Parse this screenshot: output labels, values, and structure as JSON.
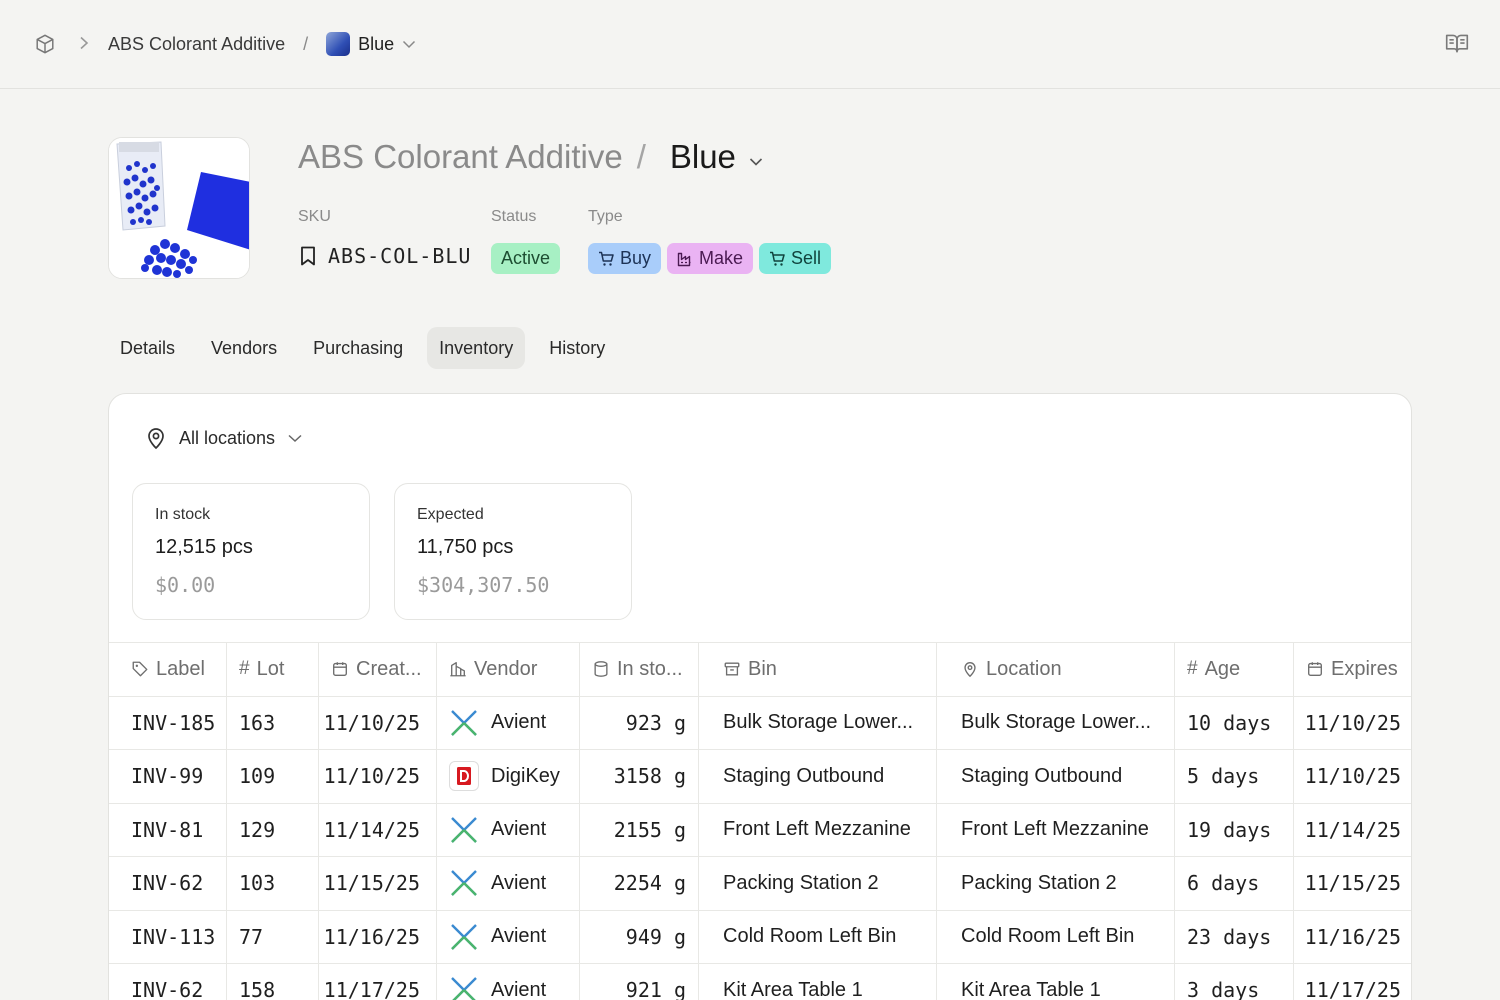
{
  "breadcrumb": {
    "parent": "ABS Colorant Additive",
    "current": "Blue"
  },
  "header": {
    "parent_title": "ABS Colorant Additive",
    "slash": "/",
    "variant_title": "Blue",
    "sku_label": "SKU",
    "sku_value": "ABS-COL-BLU",
    "status_label": "Status",
    "status_value": "Active",
    "type_label": "Type",
    "types": [
      "Buy",
      "Make",
      "Sell"
    ]
  },
  "tabs": [
    "Details",
    "Vendors",
    "Purchasing",
    "Inventory",
    "History"
  ],
  "active_tab": "Inventory",
  "location_filter": "All locations",
  "stats": {
    "in_stock": {
      "label": "In stock",
      "qty": "12,515 pcs",
      "value": "$0.00"
    },
    "expected": {
      "label": "Expected",
      "qty": "11,750 pcs",
      "value": "$304,307.50"
    }
  },
  "table": {
    "columns": [
      "Label",
      "Lot",
      "Creat...",
      "Vendor",
      "In sto...",
      "Bin",
      "Location",
      "Age",
      "Expires"
    ],
    "rows": [
      {
        "label": "INV-185",
        "lot": "163",
        "created": "11/10/25",
        "vendor": "Avient",
        "stock": "923 g",
        "bin": "Bulk Storage Lower...",
        "location": "Bulk Storage Lower...",
        "age": "10 days",
        "expires": "11/10/25"
      },
      {
        "label": "INV-99",
        "lot": "109",
        "created": "11/10/25",
        "vendor": "DigiKey",
        "stock": "3158 g",
        "bin": "Staging Outbound",
        "location": "Staging Outbound",
        "age": "5 days",
        "expires": "11/10/25"
      },
      {
        "label": "INV-81",
        "lot": "129",
        "created": "11/14/25",
        "vendor": "Avient",
        "stock": "2155 g",
        "bin": "Front Left Mezzanine",
        "location": "Front Left Mezzanine",
        "age": "19 days",
        "expires": "11/14/25"
      },
      {
        "label": "INV-62",
        "lot": "103",
        "created": "11/15/25",
        "vendor": "Avient",
        "stock": "2254 g",
        "bin": "Packing Station 2",
        "location": "Packing Station 2",
        "age": "6 days",
        "expires": "11/15/25"
      },
      {
        "label": "INV-113",
        "lot": "77",
        "created": "11/16/25",
        "vendor": "Avient",
        "stock": "949 g",
        "bin": "Cold Room Left Bin",
        "location": "Cold Room Left Bin",
        "age": "23 days",
        "expires": "11/16/25"
      },
      {
        "label": "INV-62",
        "lot": "158",
        "created": "11/17/25",
        "vendor": "Avient",
        "stock": "921 g",
        "bin": "Kit Area Table 1",
        "location": "Kit Area Table 1",
        "age": "3 days",
        "expires": "11/17/25"
      }
    ]
  },
  "colors": {
    "status_active_bg": "#a7f0c4",
    "buy_bg": "#a9cdfa",
    "make_bg": "#eab3f3",
    "sell_bg": "#7fe9dd",
    "product_blue": "#1f34d6"
  }
}
